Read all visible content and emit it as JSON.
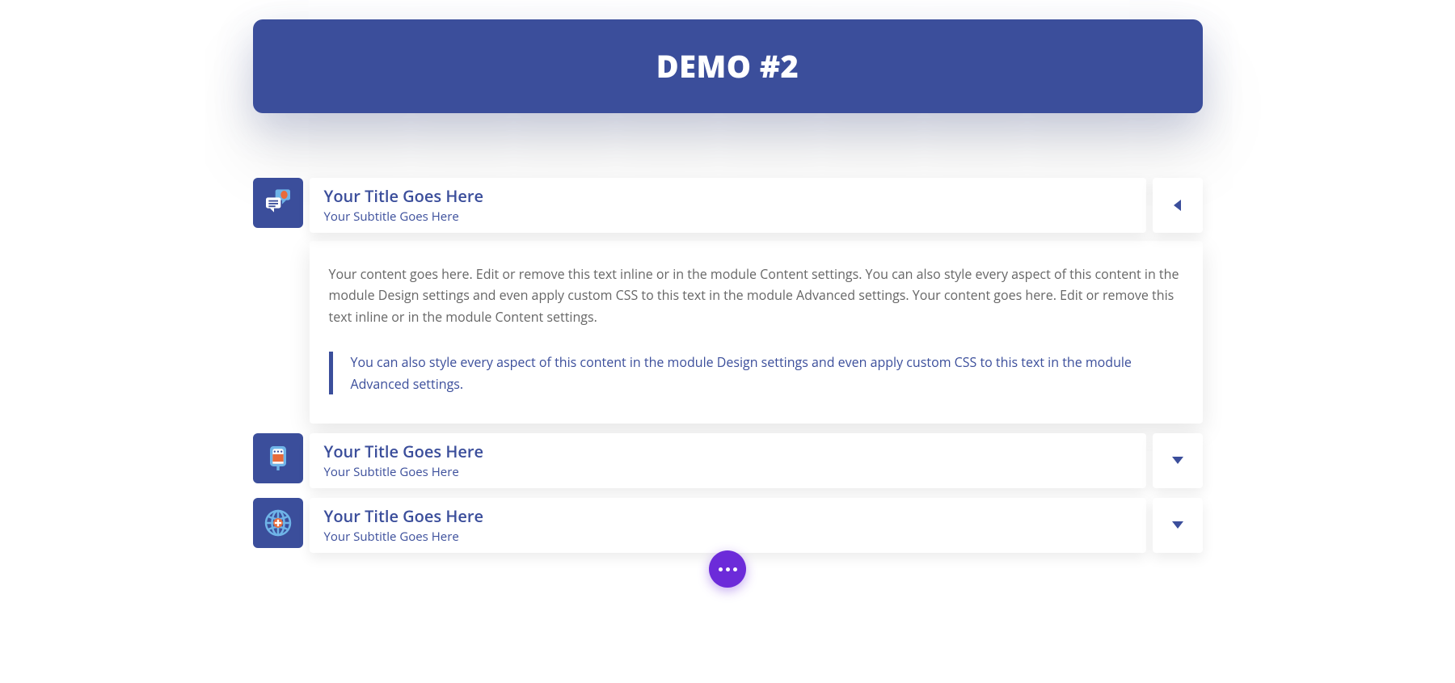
{
  "banner": {
    "title": "DEMO #2"
  },
  "items": [
    {
      "icon": "chat-icon",
      "title": "Your Title Goes Here",
      "subtitle": "Your Subtitle Goes Here",
      "expanded": true,
      "body": "Your content goes here. Edit or remove this text inline or in the module Content settings. You can also style every aspect of this content in the module Design settings and even apply custom CSS to this text in the module Advanced settings. Your content goes here. Edit or remove this text inline or in the module Content settings.",
      "quote": "You can also style every aspect of this content in the module Design settings and even apply custom CSS to this text in the module Advanced settings."
    },
    {
      "icon": "iv-bag-icon",
      "title": "Your Title Goes Here",
      "subtitle": "Your Subtitle Goes Here",
      "expanded": false
    },
    {
      "icon": "globe-plus-icon",
      "title": "Your Title Goes Here",
      "subtitle": "Your Subtitle Goes Here",
      "expanded": false
    }
  ],
  "colors": {
    "primary": "#3b4e9b",
    "accent": "#6c2bd9",
    "orange": "#e86b3a",
    "sky": "#6fb4e8"
  }
}
